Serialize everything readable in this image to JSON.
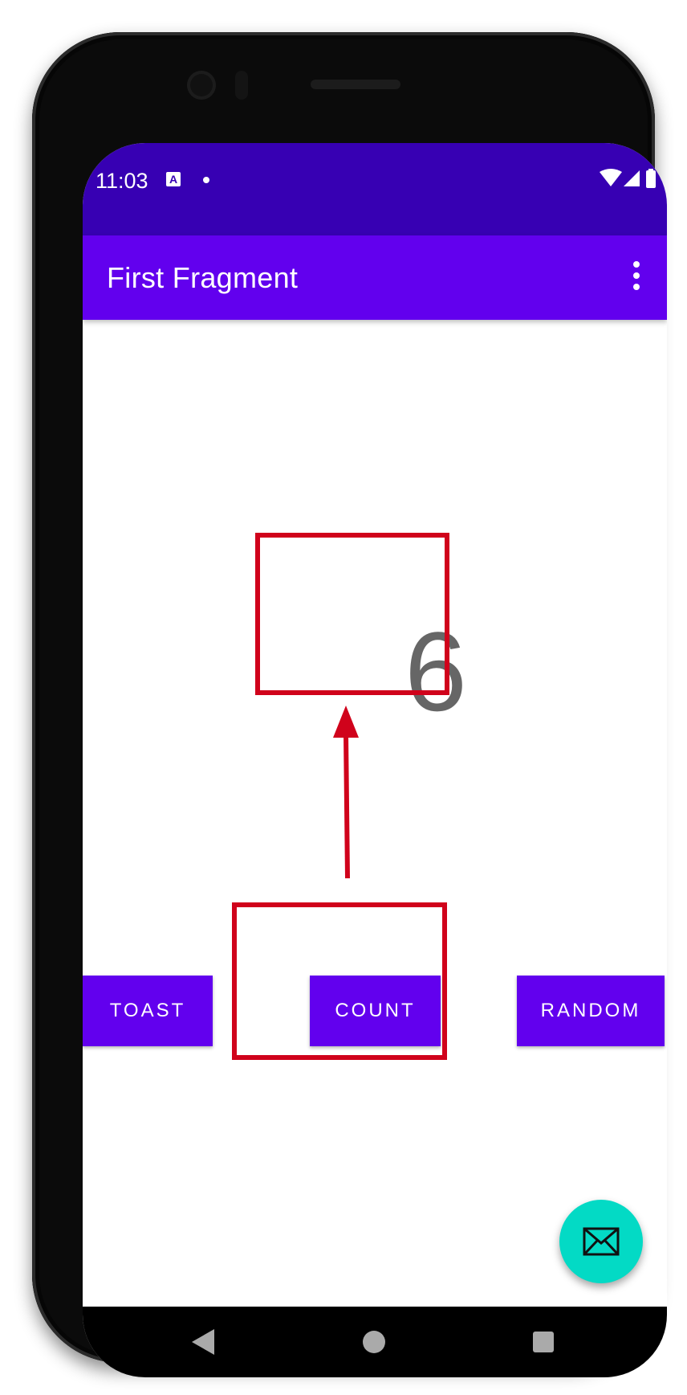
{
  "status_bar": {
    "time": "11:03",
    "notification_icon_letter": "A",
    "icons": [
      "wifi-icon",
      "cell-signal-icon",
      "battery-icon"
    ]
  },
  "app_bar": {
    "title": "First Fragment",
    "menu_icon": "more-vert-icon"
  },
  "main": {
    "count_value": "6",
    "buttons": {
      "toast": "TOAST",
      "count": "COUNT",
      "random": "RANDOM"
    }
  },
  "fab": {
    "icon": "email-icon"
  },
  "nav_bar": {
    "icons": [
      "back-icon",
      "home-icon",
      "recents-icon"
    ]
  },
  "colors": {
    "status_bar": "#3700B3",
    "app_bar": "#6200EE",
    "button": "#6200EE",
    "fab": "#03DAC5",
    "count_text": "#666666",
    "annotation": "#D0021B"
  }
}
